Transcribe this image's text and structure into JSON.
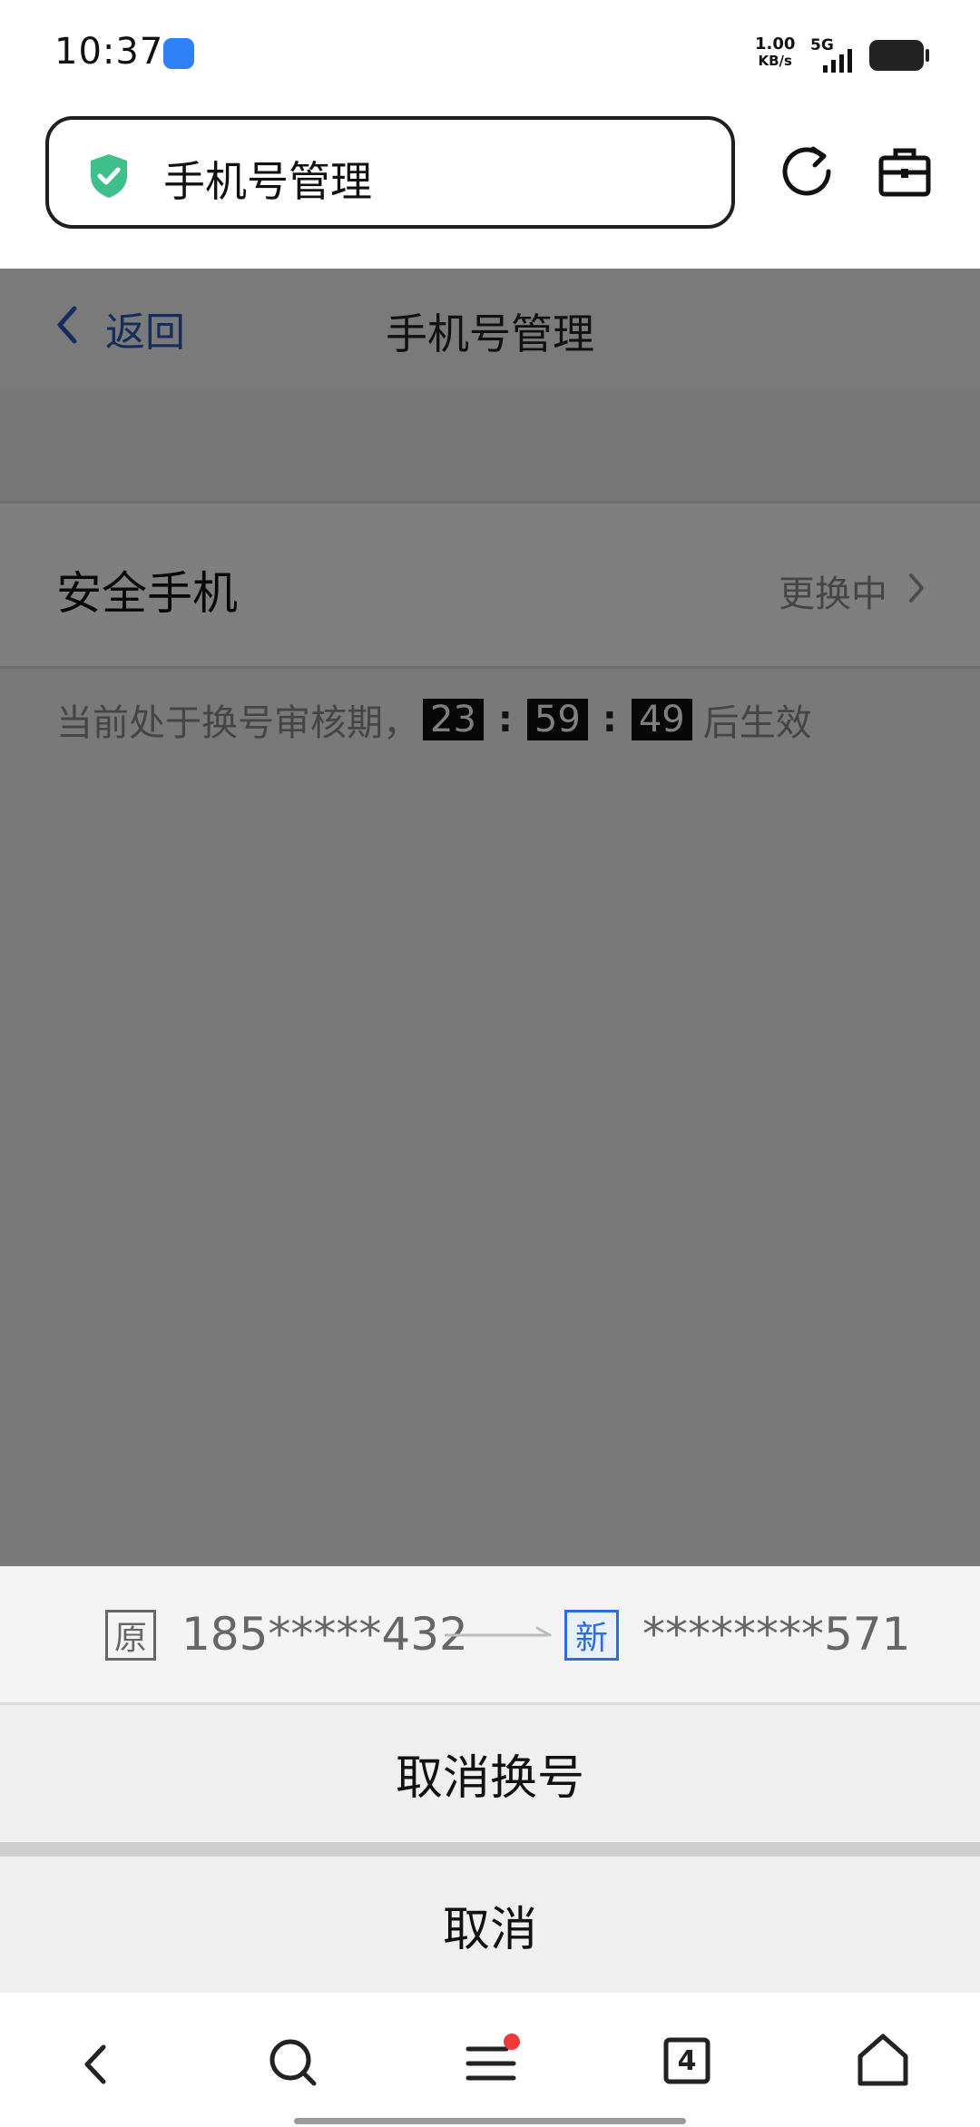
{
  "status_bar": {
    "time": "10:37",
    "net_speed_value": "1.00",
    "net_speed_unit": "KB/s",
    "network": "5G"
  },
  "browser": {
    "url_title": "手机号管理",
    "icons": [
      "shield-check-icon",
      "refresh-icon",
      "briefcase-icon"
    ]
  },
  "header": {
    "back_label": "返回",
    "title": "手机号管理"
  },
  "security_phone": {
    "label": "安全手机",
    "status": "更换中"
  },
  "notice": {
    "prefix": "当前处于换号审核期，",
    "hours": "23",
    "minutes": "59",
    "seconds": "49",
    "separator": ":",
    "suffix": "后生效"
  },
  "sheet": {
    "old_tag": "原",
    "old_number": "185*****432",
    "new_tag": "新",
    "new_number": "********571",
    "cancel_change_label": "取消换号",
    "cancel_label": "取消"
  },
  "bottom_nav": {
    "tab_count": "4",
    "icons": [
      "back-icon",
      "search-icon",
      "menu-icon",
      "tabs-icon",
      "home-icon"
    ]
  },
  "colors": {
    "link_blue": "#2a5ab8",
    "new_tag_blue": "#2a6de0",
    "shield_green": "#3fc08a",
    "notification_red": "#f03a3a"
  }
}
